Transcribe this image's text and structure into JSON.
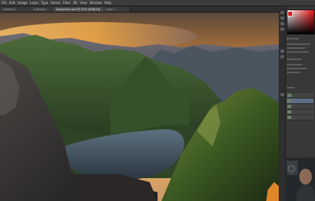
{
  "menu": [
    "File",
    "Edit",
    "Image",
    "Layer",
    "Type",
    "Select",
    "Filter",
    "3D",
    "View",
    "Window",
    "Help"
  ],
  "tabs": [
    {
      "label": "Untitled-1"
    },
    {
      "label": "Untitled-2"
    },
    {
      "label": "Segla-final.psd @ 25% (RGB/16)"
    },
    {
      "label": "Layer 1"
    }
  ],
  "panel": {
    "labels": [
      "Properties",
      "Adjustments",
      "Layers"
    ]
  },
  "colors": {
    "foreground": "#e01818",
    "panel_bg": "#383838",
    "canvas_bg": "#2b2b2b"
  }
}
